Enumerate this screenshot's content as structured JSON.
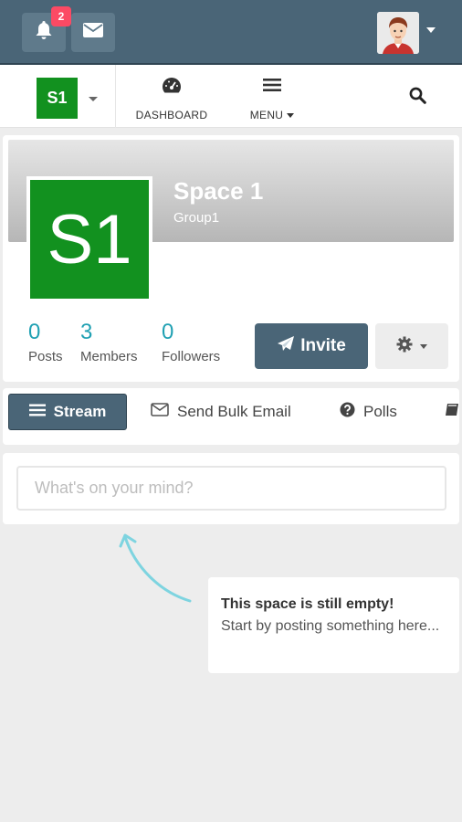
{
  "topbar": {
    "notification_count": "2",
    "icons": {
      "bell": "bell-icon",
      "mail": "envelope-icon",
      "avatar": "user-avatar"
    }
  },
  "navbar": {
    "space_chip": "S1",
    "dashboard_label": "DASHBOARD",
    "menu_label": "MENU",
    "icons": {
      "dashboard": "tachometer-icon",
      "menu": "bars-icon",
      "search": "search-icon"
    }
  },
  "space": {
    "logo_text": "S1",
    "title": "Space 1",
    "subtitle": "Group1",
    "stats": [
      {
        "value": "0",
        "label": "Posts"
      },
      {
        "value": "3",
        "label": "Members"
      },
      {
        "value": "0",
        "label": "Followers"
      }
    ],
    "invite_label": "Invite"
  },
  "tabs": [
    {
      "label": "Stream",
      "icon": "bars-icon",
      "active": true
    },
    {
      "label": "Send Bulk Email",
      "icon": "envelope-outline-icon",
      "active": false
    },
    {
      "label": "Polls",
      "icon": "question-circle-icon",
      "active": false
    }
  ],
  "post": {
    "placeholder": "What's on your mind?"
  },
  "empty_state": {
    "title": "This space is still empty!",
    "body": "Start by posting something here..."
  },
  "colors": {
    "header": "#4a6577",
    "space_green": "#12911f",
    "stat_teal": "#21a1b3",
    "badge_red": "#fc4a64",
    "arrow_teal": "#7ed4e0"
  }
}
